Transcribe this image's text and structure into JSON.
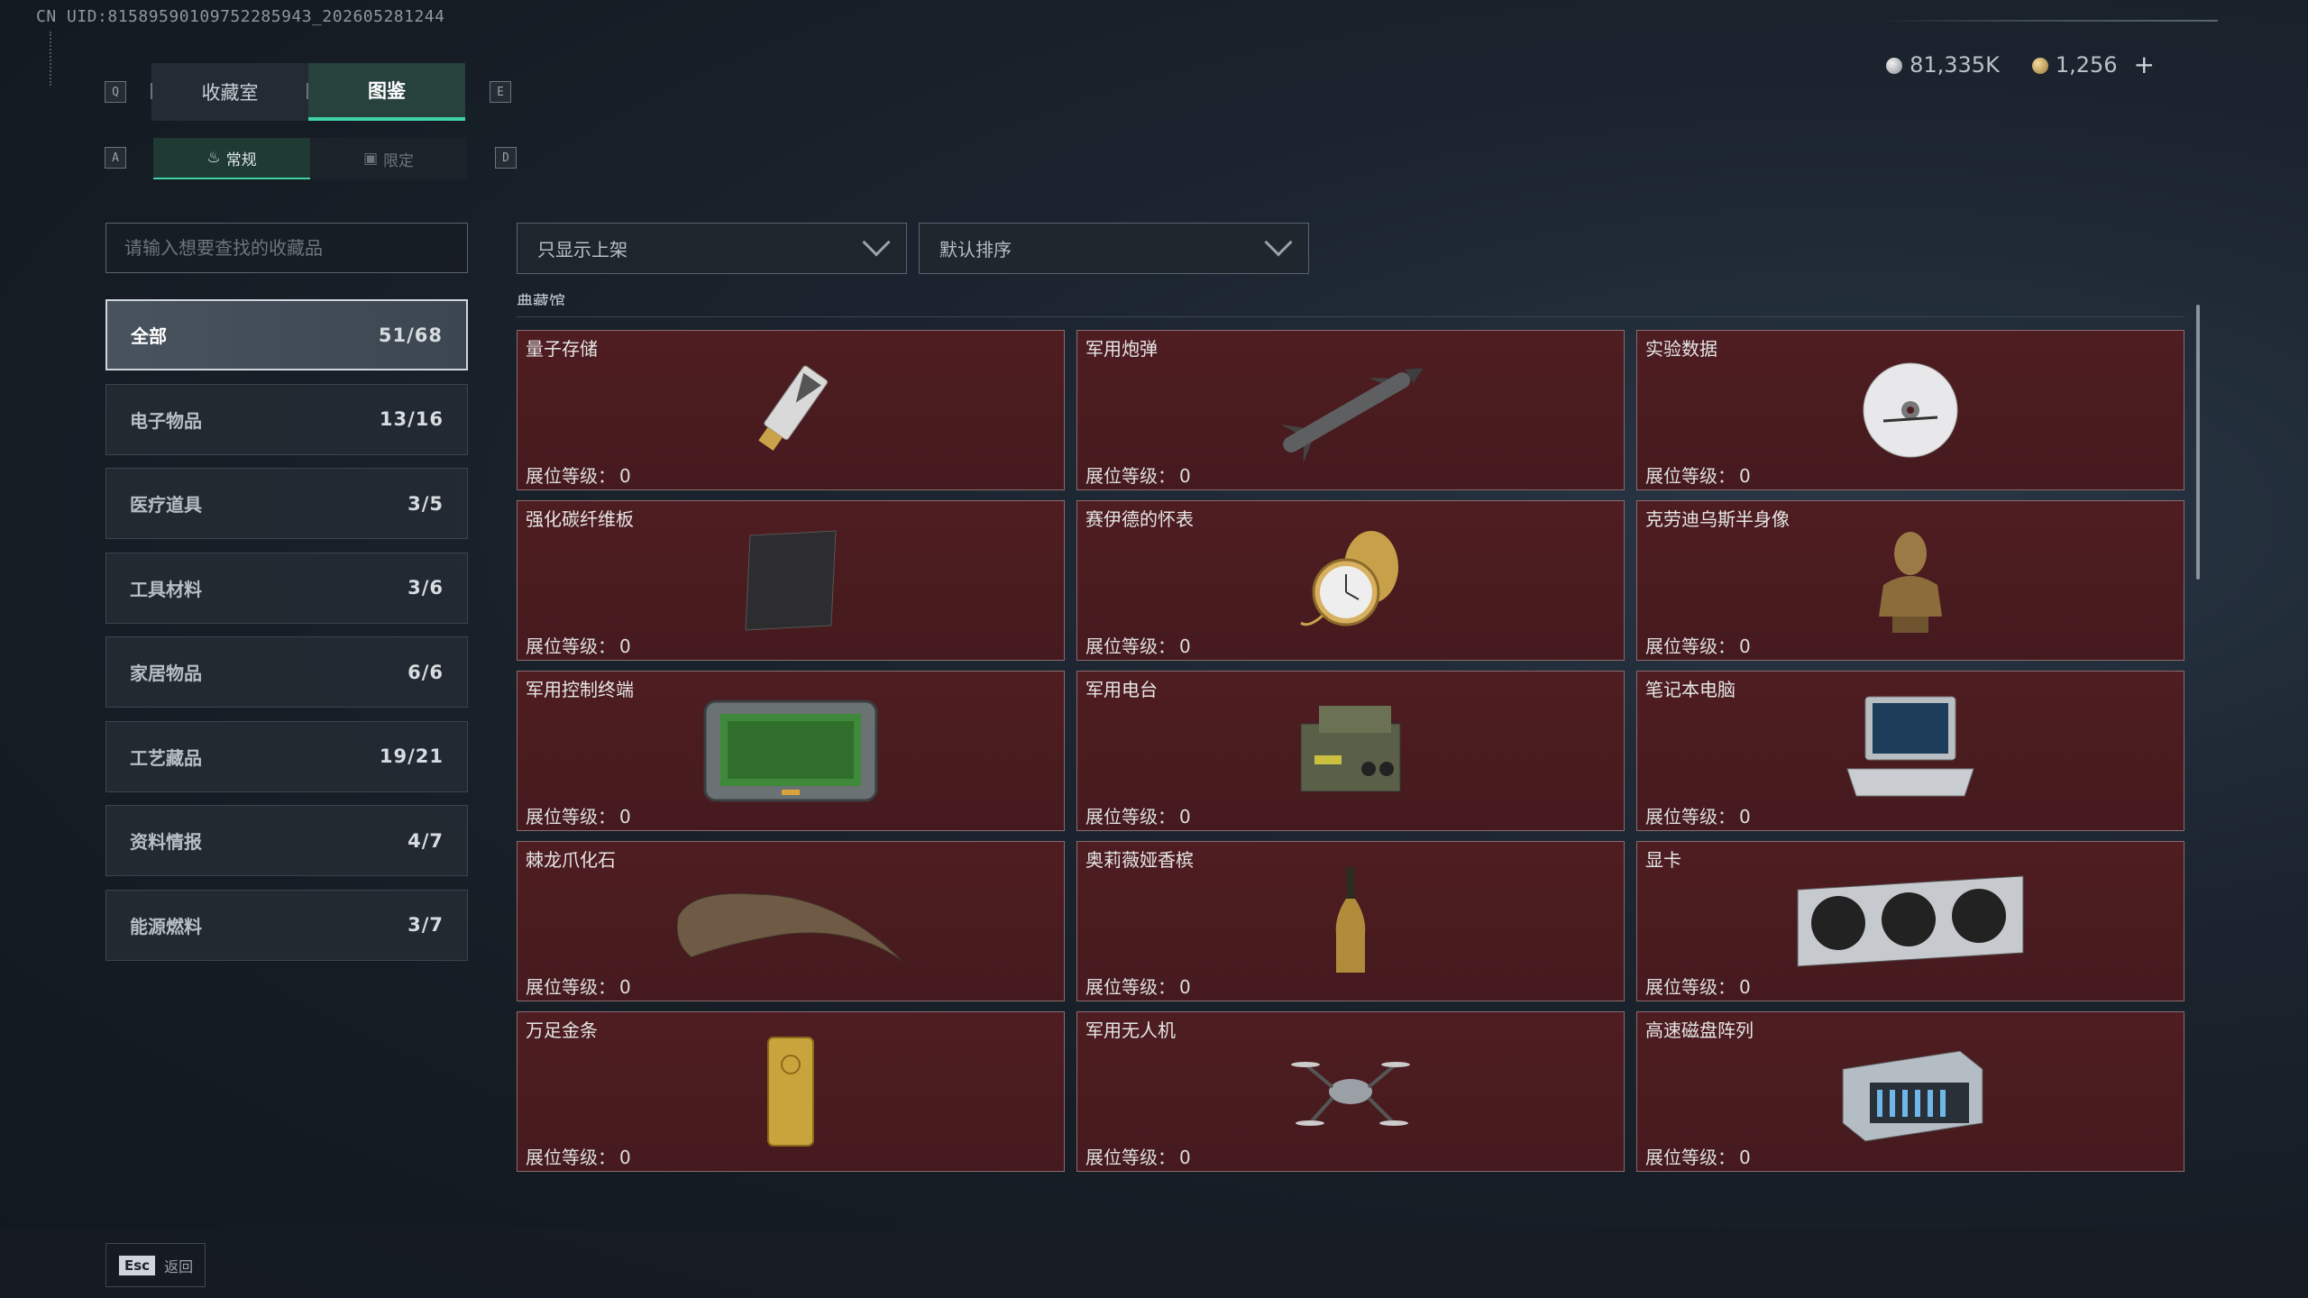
{
  "uid": "CN UID:8158959010975228594​3_202605281244",
  "currency": {
    "silver": "81,335K",
    "gold": "1,256",
    "add": "+"
  },
  "keys": {
    "q": "Q",
    "e": "E",
    "a": "A",
    "d": "D"
  },
  "tabs": [
    {
      "label": "收藏室"
    },
    {
      "label": "图鉴"
    }
  ],
  "subtabs": [
    {
      "label": "常规"
    },
    {
      "label": "限定"
    }
  ],
  "search": {
    "placeholder": "请输入想要查找的收藏品"
  },
  "categories": [
    {
      "label": "全部",
      "count": "51/68"
    },
    {
      "label": "电子物品",
      "count": "13/16"
    },
    {
      "label": "医疗道具",
      "count": "3/5"
    },
    {
      "label": "工具材料",
      "count": "3/6"
    },
    {
      "label": "家居物品",
      "count": "6/6"
    },
    {
      "label": "工艺藏品",
      "count": "19/21"
    },
    {
      "label": "资料情报",
      "count": "4/7"
    },
    {
      "label": "能源燃料",
      "count": "3/7"
    }
  ],
  "filters": {
    "shelf": "只显示上架",
    "sort": "默认排序"
  },
  "section_label": "典藏馆",
  "level_label": "展位等级：",
  "items": [
    {
      "name": "量子存储",
      "level": "0",
      "icon": "usb-drive-icon"
    },
    {
      "name": "军用炮弹",
      "level": "0",
      "icon": "missile-icon"
    },
    {
      "name": "实验数据",
      "level": "0",
      "icon": "disc-icon"
    },
    {
      "name": "强化碳纤维板",
      "level": "0",
      "icon": "carbon-plate-icon"
    },
    {
      "name": "赛伊德的怀表",
      "level": "0",
      "icon": "pocket-watch-icon"
    },
    {
      "name": "克劳迪乌斯半身像",
      "level": "0",
      "icon": "bust-icon"
    },
    {
      "name": "军用控制终端",
      "level": "0",
      "icon": "control-terminal-icon"
    },
    {
      "name": "军用电台",
      "level": "0",
      "icon": "radio-icon"
    },
    {
      "name": "笔记本电脑",
      "level": "0",
      "icon": "laptop-icon"
    },
    {
      "name": "棘龙爪化石",
      "level": "0",
      "icon": "claw-fossil-icon"
    },
    {
      "name": "奥莉薇娅香槟",
      "level": "0",
      "icon": "champagne-icon"
    },
    {
      "name": "显卡",
      "level": "0",
      "icon": "gpu-icon"
    },
    {
      "name": "万足金条",
      "level": "0",
      "icon": "gold-bar-icon"
    },
    {
      "name": "军用无人机",
      "level": "0",
      "icon": "drone-icon"
    },
    {
      "name": "高速磁盘阵列",
      "level": "0",
      "icon": "disk-array-icon"
    }
  ],
  "footer": {
    "esc_key": "Esc",
    "back": "返回"
  }
}
